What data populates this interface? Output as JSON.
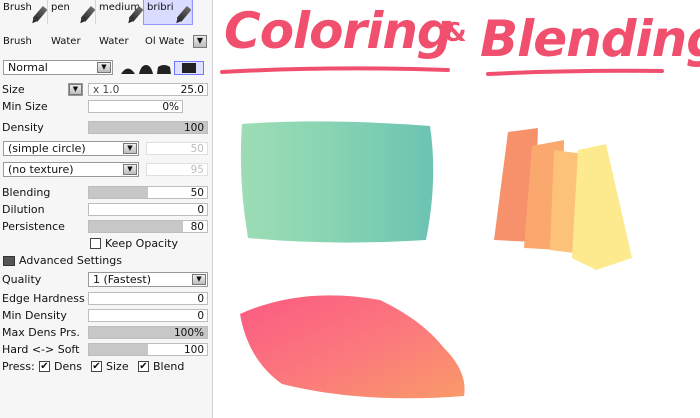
{
  "brushes": {
    "top": [
      "Brush",
      "pen",
      "medium",
      "bribri"
    ],
    "bottom": [
      "Brush",
      "Water",
      "Water",
      "Ol Wate"
    ],
    "selected_index": 3
  },
  "blend_mode": "Normal",
  "size": {
    "label": "Size",
    "multiplier": "x 1.0",
    "value": "25.0"
  },
  "min_size": {
    "label": "Min Size",
    "value": "0%"
  },
  "density": {
    "label": "Density",
    "value": "100",
    "level": 1.0
  },
  "shape_dropdown": "(simple circle)",
  "shape_value": "50",
  "texture_dropdown": "(no texture)",
  "texture_value": "95",
  "blending": {
    "label": "Blending",
    "value": "50",
    "level": 0.5
  },
  "dilution": {
    "label": "Dilution",
    "value": "0",
    "level": 0
  },
  "persistence": {
    "label": "Persistence",
    "value": "80",
    "level": 0.8
  },
  "keep_opacity": {
    "label": "Keep Opacity",
    "checked": false
  },
  "advanced": {
    "header": "Advanced Settings",
    "quality_label": "Quality",
    "quality_value": "1 (Fastest)",
    "edge_hardness": {
      "label": "Edge Hardness",
      "value": "0"
    },
    "min_density": {
      "label": "Min Density",
      "value": "0"
    },
    "max_dens_prs": {
      "label": "Max Dens Prs.",
      "value": "100%",
      "level": 1.0
    },
    "hard_soft": {
      "label": "Hard <-> Soft",
      "value": "100",
      "level": 0.5
    }
  },
  "press": {
    "label": "Press:",
    "options": [
      "Dens",
      "Size",
      "Blend"
    ]
  },
  "canvas": {
    "title_left": "Coloring",
    "title_amp": "&",
    "title_right": "Blending",
    "title_color": "#f0506e"
  },
  "icons": {
    "checkmark": "✔",
    "dropdown": "▼"
  }
}
